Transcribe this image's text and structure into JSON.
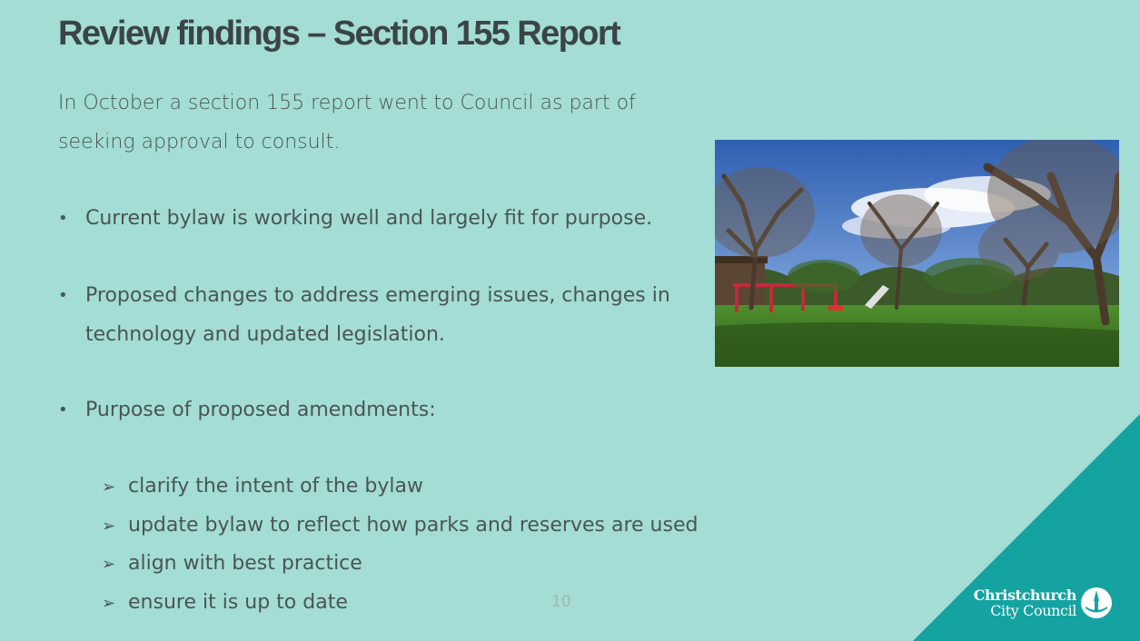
{
  "slide": {
    "title": "Review findings – Section 155 Report",
    "intro": "In October a section 155 report went to Council as part of seeking approval to consult.",
    "bullets": [
      "Current bylaw is working well and largely fit for purpose.",
      "Proposed changes to address emerging issues, changes in technology and updated legislation.",
      "Purpose of proposed amendments:"
    ],
    "sub_bullets": [
      "clarify the intent of the bylaw",
      "update bylaw to reflect how parks and reserves are used",
      "align with best practice",
      "ensure it is up to date"
    ],
    "bullet_glyph": "•",
    "arrow_glyph": "➢",
    "page_number": "10"
  },
  "logo": {
    "line1": "Christchurch",
    "line2": "City Council"
  },
  "colors": {
    "background": "#a3ddd5",
    "accent_triangle": "#14a3a1",
    "text": "#4a5555"
  }
}
